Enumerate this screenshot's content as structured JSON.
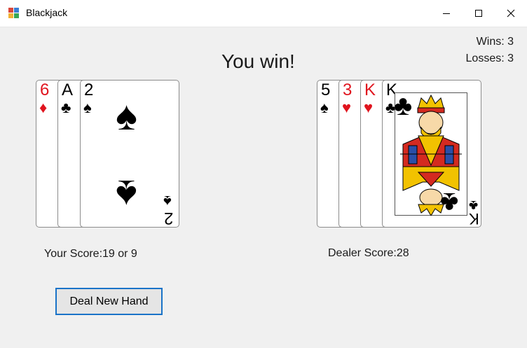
{
  "window": {
    "title": "Blackjack"
  },
  "status": {
    "wins": "Wins: 3",
    "losses": "Losses: 3",
    "result": "You win!"
  },
  "player": {
    "score_label": "Your Score:19 or 9",
    "cards": [
      {
        "rank": "6",
        "suit": "♦",
        "suit_name": "diamonds",
        "color": "#e0141e"
      },
      {
        "rank": "A",
        "suit": "♣",
        "suit_name": "clubs",
        "color": "#000000"
      },
      {
        "rank": "2",
        "suit": "♠",
        "suit_name": "spades",
        "color": "#000000"
      }
    ]
  },
  "dealer": {
    "score_label": "Dealer Score:28",
    "cards": [
      {
        "rank": "5",
        "suit": "♠",
        "suit_name": "spades",
        "color": "#000000"
      },
      {
        "rank": "3",
        "suit": "♥",
        "suit_name": "hearts",
        "color": "#e0141e"
      },
      {
        "rank": "K",
        "suit": "♥",
        "suit_name": "hearts",
        "color": "#e0141e"
      },
      {
        "rank": "K",
        "suit": "♣",
        "suit_name": "clubs",
        "color": "#000000"
      }
    ]
  },
  "actions": {
    "deal_label": "Deal New Hand"
  },
  "colors": {
    "focus_border": "#1a73c8",
    "red_suit": "#e0141e",
    "background": "#f0f0f0"
  }
}
